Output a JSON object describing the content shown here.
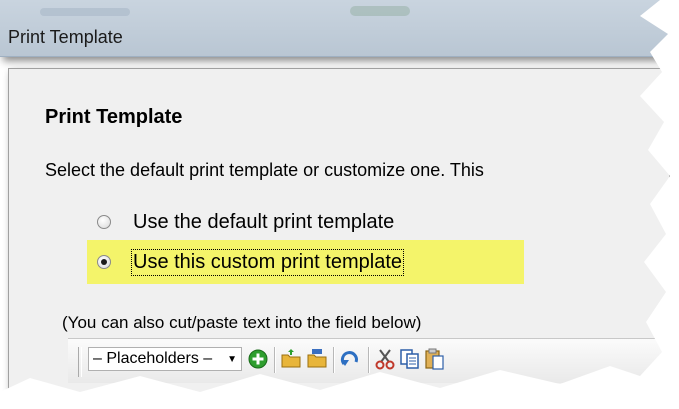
{
  "window": {
    "title": "Print Template"
  },
  "section": {
    "heading": "Print Template",
    "description": "Select the default print template or customize one.  This"
  },
  "options": [
    {
      "label": "Use the default print template",
      "checked": false
    },
    {
      "label": "Use this custom print template",
      "checked": true
    }
  ],
  "hint": "(You can also cut/paste text into the field below)",
  "toolbar": {
    "placeholders_value": "– Placeholders –",
    "icons": [
      "add-icon",
      "open-folder-icon",
      "save-folder-icon",
      "undo-icon",
      "cut-icon",
      "copy-icon",
      "paste-icon"
    ]
  },
  "colors": {
    "highlight": "#f4f46a",
    "add": "#2e9e2e",
    "folder": "#e8b53a",
    "undo": "#2d6fc2",
    "cut": "#c0392b"
  }
}
